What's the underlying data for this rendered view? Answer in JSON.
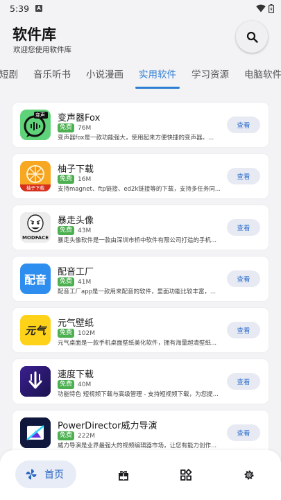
{
  "status_bar": {
    "time": "5:39",
    "notification_icon": "a-badge-icon",
    "wifi_icon": "wifi-icon",
    "battery_icon": "battery-icon",
    "a_badge": "A"
  },
  "header": {
    "title": "软件库",
    "subtitle": "欢迎您使用软件库",
    "search_icon": "search-icon"
  },
  "tabs": [
    {
      "label": "短剧"
    },
    {
      "label": "音乐听书"
    },
    {
      "label": "小说漫画"
    },
    {
      "label": "实用软件",
      "active": true
    },
    {
      "label": "学习资源"
    },
    {
      "label": "电脑软件"
    }
  ],
  "apps": [
    {
      "name": "变声器Fox",
      "badge": "免费",
      "size": "76M",
      "desc": "变声器fox是一款功能强大，使用起来方便快捷的变声器。...",
      "button": "查看",
      "icon": "voice-changer-icon",
      "icon_text": "变声"
    },
    {
      "name": "柚子下载",
      "badge": "免费",
      "size": "16M",
      "desc": "支持magnet、ftp链接、ed2k链接等的下载，支持多任务同...",
      "button": "查看",
      "icon": "pomelo-download-icon",
      "icon_text": "柚子下载"
    },
    {
      "name": "暴走头像",
      "badge": "免费",
      "size": "43M",
      "desc": "暴走头像软件是一款由深圳市桥中软件有限公司打造的手机...",
      "button": "查看",
      "icon": "rage-face-icon",
      "icon_text": "MODFACE"
    },
    {
      "name": "配音工厂",
      "badge": "免费",
      "size": "41M",
      "desc": "配音工厂app是一款用来配音的软件，里面功能比较丰富，...",
      "button": "查看",
      "icon": "dubbing-icon",
      "icon_text": "配音"
    },
    {
      "name": "元气壁纸",
      "badge": "免费",
      "size": "102M",
      "desc": "元气桌面是一款手机桌面壁纸美化软件，拥有海量超清壁纸...",
      "button": "查看",
      "icon": "wallpaper-icon",
      "icon_text": "元气"
    },
    {
      "name": "速度下载",
      "badge": "免费",
      "size": "40M",
      "desc": "功能特色 短视频下载与高级管理 - 支持短视频下载，为您提...",
      "button": "查看",
      "icon": "speed-download-icon",
      "icon_text": ""
    },
    {
      "name": "PowerDirector威力导演",
      "badge": "免费",
      "size": "222M",
      "desc": "威力导演是业界最强大的视频编辑器市场，让您有能力创作...",
      "button": "查看",
      "icon": "powerdirector-icon",
      "icon_text": ""
    }
  ],
  "bottom_nav": {
    "home_label": "首页",
    "items": [
      {
        "name": "home",
        "icon": "pinwheel-icon"
      },
      {
        "name": "gift",
        "icon": "gift-icon"
      },
      {
        "name": "apps",
        "icon": "apps-grid-icon"
      },
      {
        "name": "settings",
        "icon": "gear-icon"
      }
    ]
  },
  "colors": {
    "accent": "#2d7dd2",
    "free_badge": "#4caf50",
    "background": "#f3f3f6"
  }
}
